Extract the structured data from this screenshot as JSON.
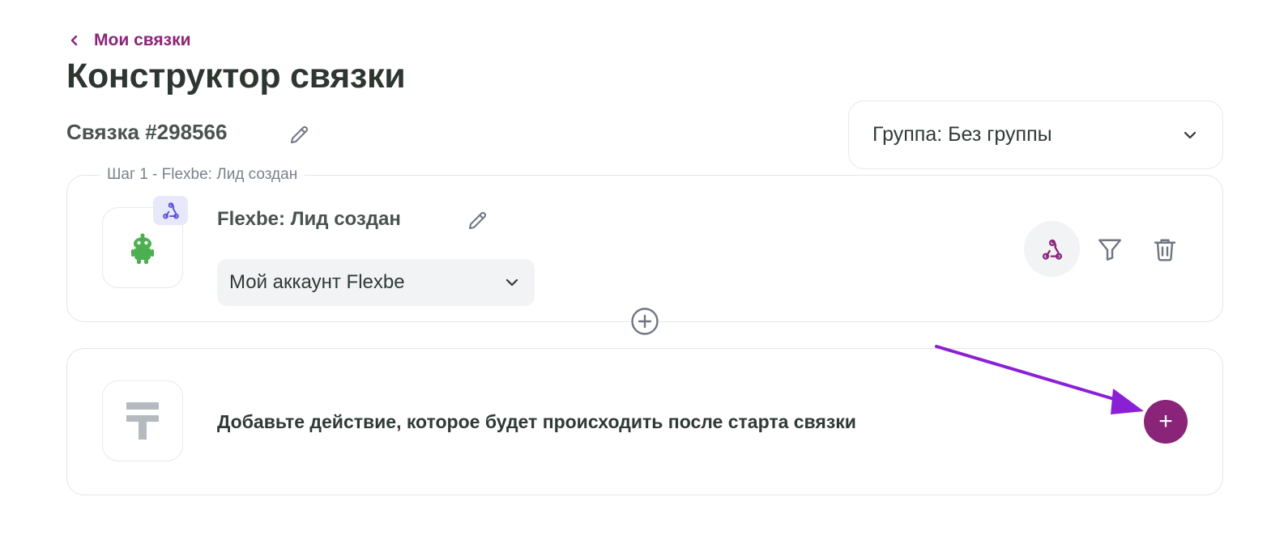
{
  "breadcrumb": {
    "back_label": "Мои связки"
  },
  "page": {
    "title": "Конструктор связки"
  },
  "bundle": {
    "name": "Связка #298566"
  },
  "group_select": {
    "value": "Группа: Без группы"
  },
  "step1": {
    "legend": "Шаг 1 - Flexbe: Лид создан",
    "name": "Flexbe: Лид создан",
    "account_value": "Мой аккаунт Flexbe"
  },
  "action_block": {
    "text": "Добавьте действие, которое будет происходить после старта связки",
    "add_button_label": "+"
  },
  "colors": {
    "brand": "#8a2479",
    "app_icon_green": "#4caf50",
    "webhook_badge_bg": "#e7e8fb",
    "arrow": "#8b1fd6"
  },
  "icons": [
    "chevron-left-icon",
    "pencil-icon",
    "chevron-down-icon",
    "flexbe-robot-icon",
    "webhook-icon",
    "filter-icon",
    "trash-icon",
    "plus-circle-icon",
    "action-placeholder-icon",
    "plus-icon",
    "arrow-annotation"
  ]
}
